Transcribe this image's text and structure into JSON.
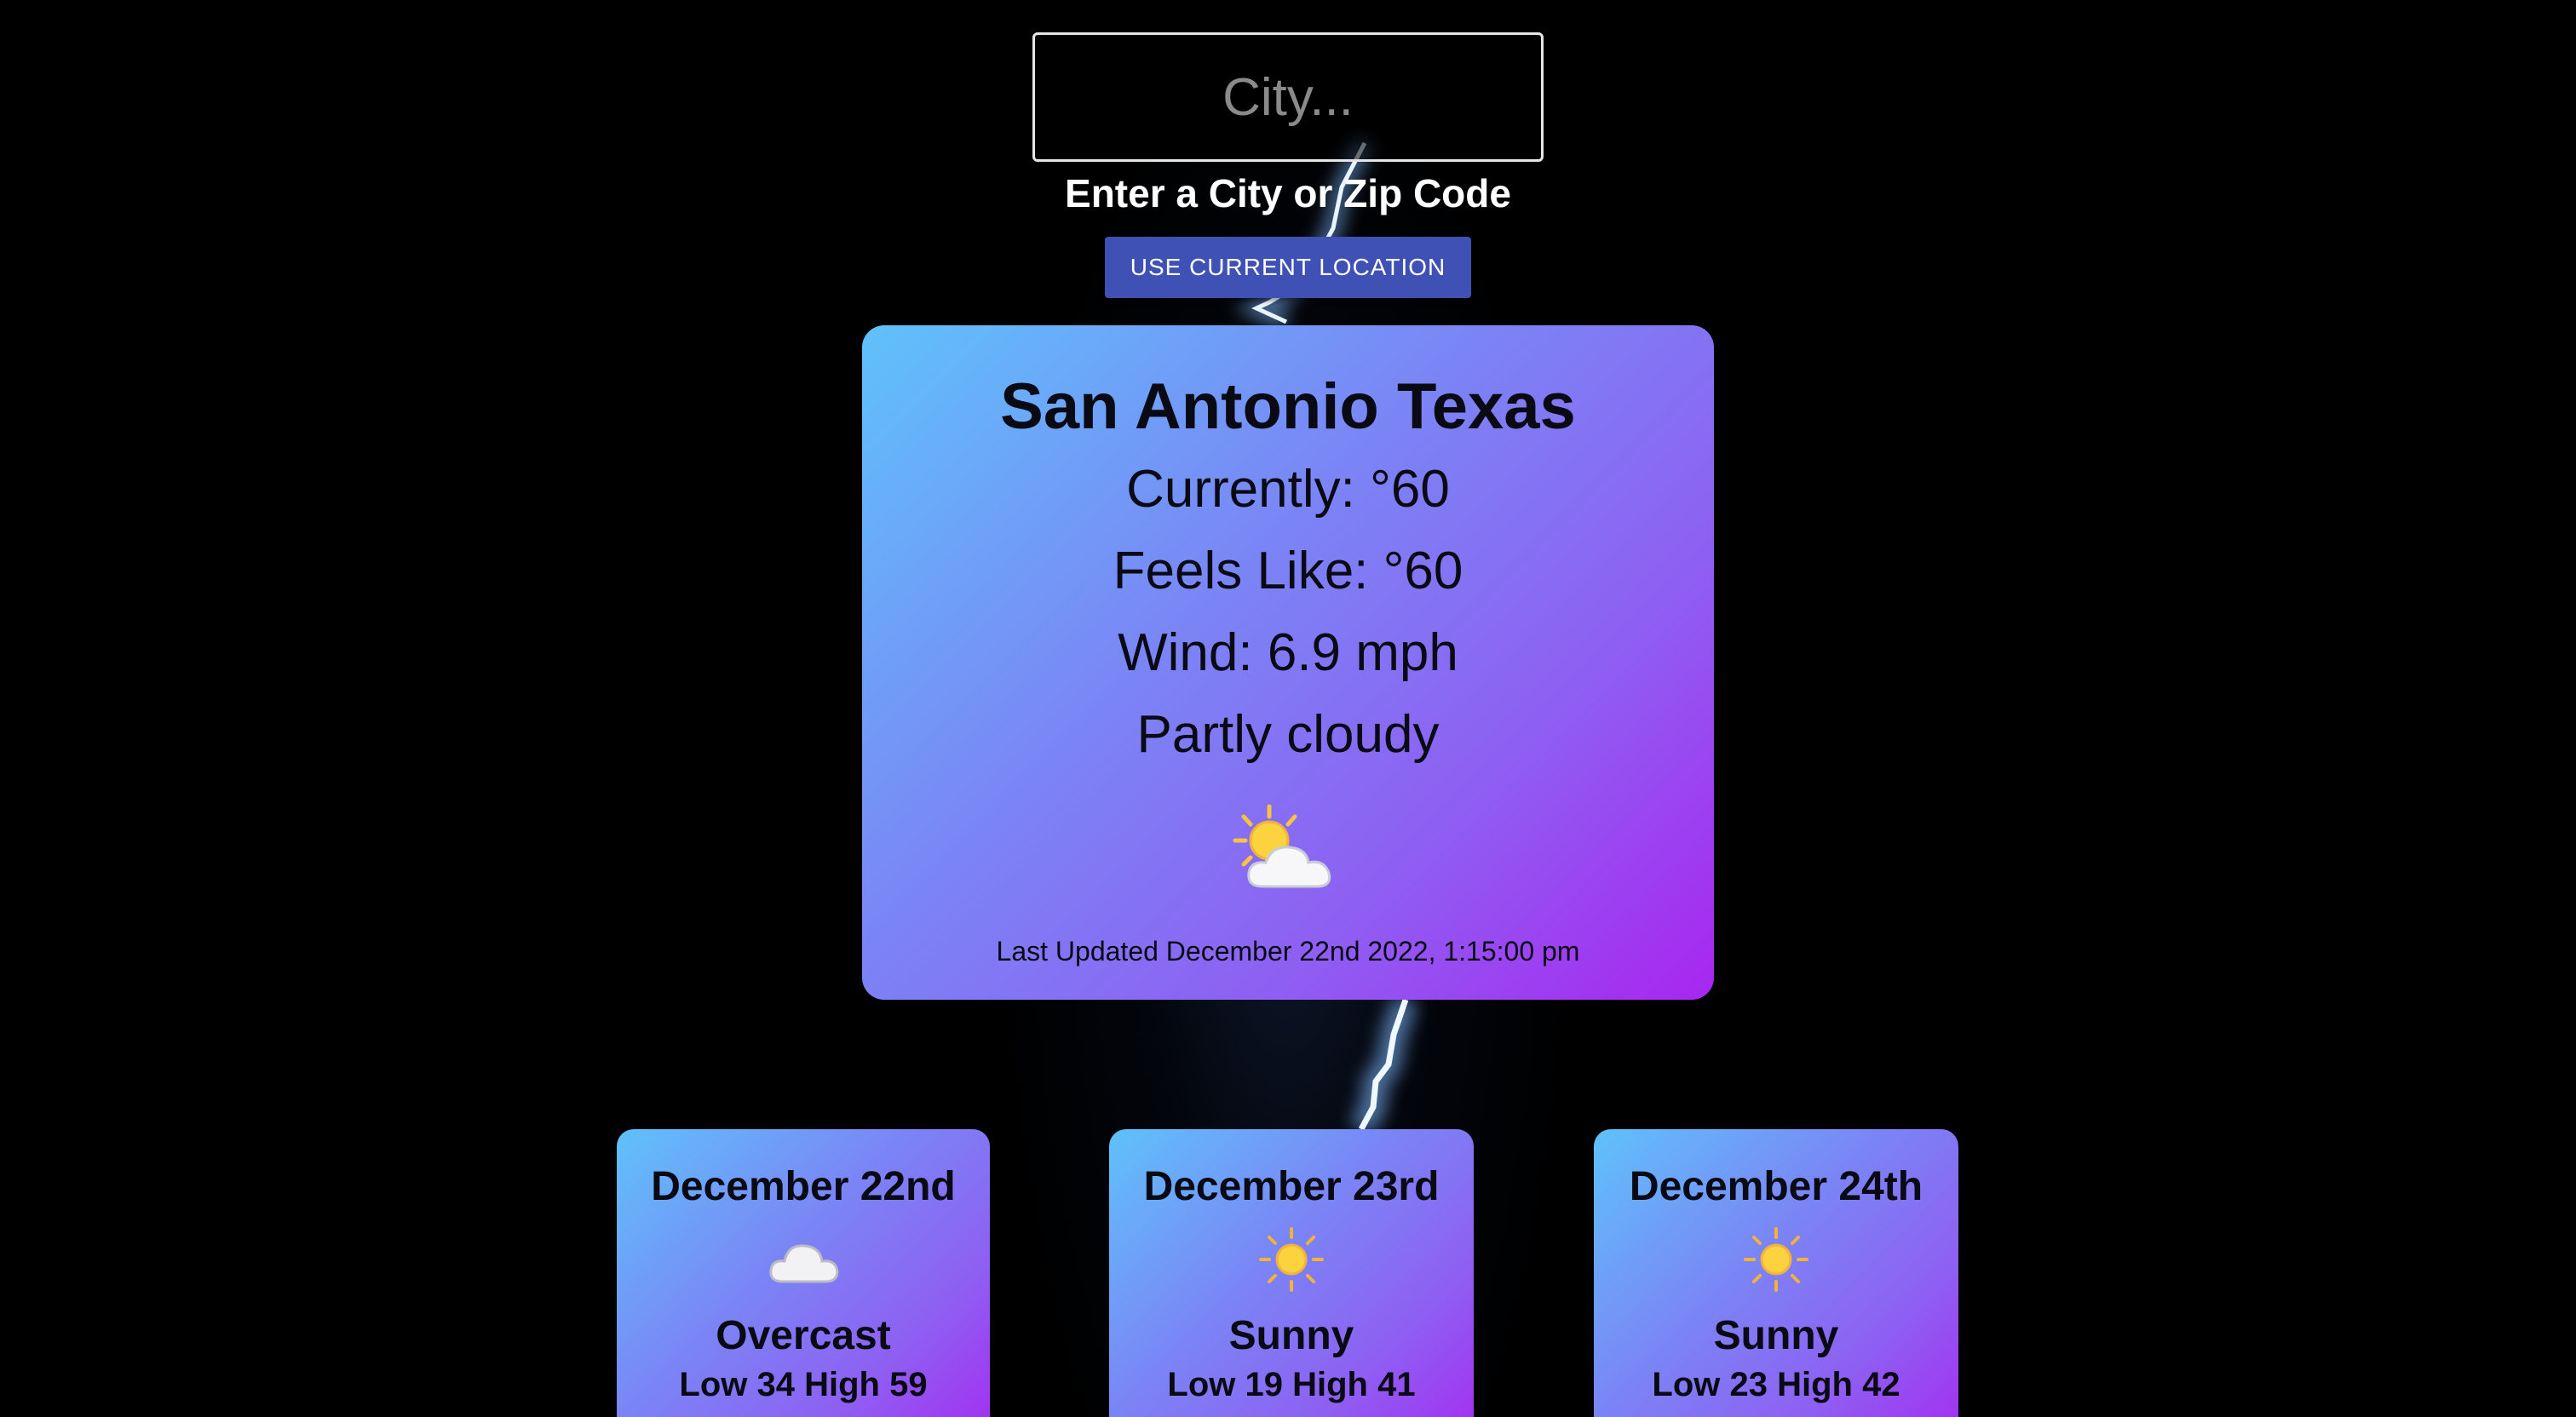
{
  "search": {
    "placeholder": "City...",
    "value": ""
  },
  "helper_text": "Enter a City or Zip Code",
  "location_button_label": "USE CURRENT LOCATION",
  "current": {
    "city": "San Antonio Texas",
    "currently": "Currently: °60",
    "feels_like": "Feels Like: °60",
    "wind": "Wind: 6.9 mph",
    "condition": "Partly cloudy",
    "icon": "partly-cloudy-icon",
    "last_updated": "Last Updated December 22nd 2022, 1:15:00 pm"
  },
  "forecast": [
    {
      "date": "December 22nd",
      "icon": "cloud-icon",
      "condition": "Overcast",
      "range": "Low 34 High 59"
    },
    {
      "date": "December 23rd",
      "icon": "sun-icon",
      "condition": "Sunny",
      "range": "Low 19 High 41"
    },
    {
      "date": "December 24th",
      "icon": "sun-icon",
      "condition": "Sunny",
      "range": "Low 23 High 42"
    }
  ],
  "colors": {
    "background": "#000000",
    "button": "#3f51b5",
    "card_gradient_start": "#5fc2fb",
    "card_gradient_end": "#a826f0"
  }
}
